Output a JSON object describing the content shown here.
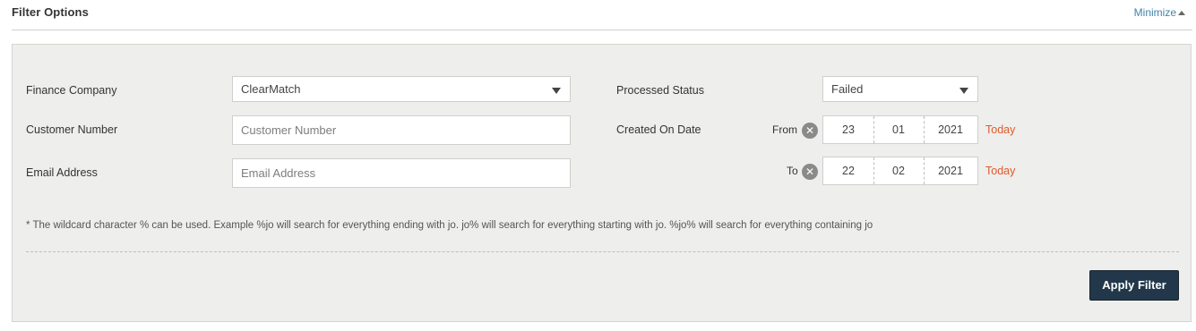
{
  "header": {
    "title": "Filter Options",
    "minimize_label": "Minimize"
  },
  "filters": {
    "finance_company": {
      "label": "Finance Company",
      "value": "ClearMatch"
    },
    "customer_number": {
      "label": "Customer Number",
      "placeholder": "Customer Number",
      "value": ""
    },
    "email_address": {
      "label": "Email Address",
      "placeholder": "Email Address",
      "value": ""
    },
    "processed_status": {
      "label": "Processed Status",
      "value": "Failed"
    },
    "created_on_date": {
      "label": "Created On Date",
      "from": {
        "label": "From",
        "day": "23",
        "month": "01",
        "year": "2021",
        "today_label": "Today"
      },
      "to": {
        "label": "To",
        "day": "22",
        "month": "02",
        "year": "2021",
        "today_label": "Today"
      }
    }
  },
  "note": "* The wildcard character % can be used. Example %jo will search for everything ending with jo. jo% will search for everything starting with jo. %jo% will search for everything containing jo",
  "apply_label": "Apply Filter",
  "icons": {
    "clear": "clear-circle-icon",
    "dropdown": "chevron-down-icon",
    "minimize": "caret-up-icon"
  },
  "colors": {
    "accent_link": "#3f84a8",
    "today_link": "#e05a2b",
    "button_bg": "#22384a",
    "panel_bg": "#eeeeec"
  }
}
